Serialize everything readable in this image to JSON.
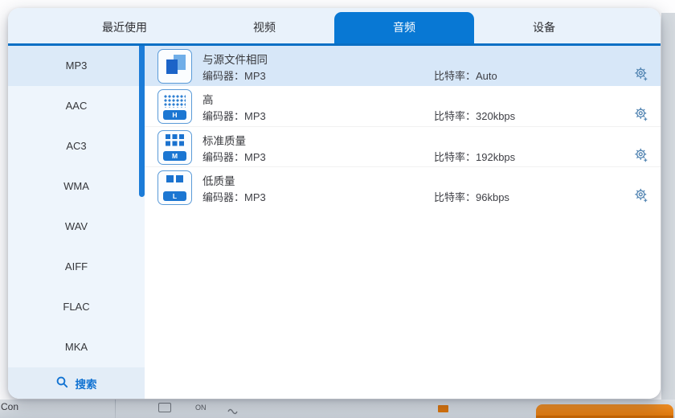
{
  "tabs": [
    {
      "label": "最近使用"
    },
    {
      "label": "视频"
    },
    {
      "label": "音频"
    },
    {
      "label": "设备"
    }
  ],
  "sidebar": {
    "items": [
      {
        "label": "MP3"
      },
      {
        "label": "AAC"
      },
      {
        "label": "AC3"
      },
      {
        "label": "WMA"
      },
      {
        "label": "WAV"
      },
      {
        "label": "AIFF"
      },
      {
        "label": "FLAC"
      },
      {
        "label": "MKA"
      }
    ],
    "search_label": "搜索"
  },
  "presets": [
    {
      "title": "与源文件相同",
      "encoder": "编码器：MP3",
      "bitrate": "比特率：Auto",
      "badge": "",
      "icon": "same-as-source-icon"
    },
    {
      "title": "高",
      "encoder": "编码器：MP3",
      "bitrate": "比特率：320kbps",
      "badge": "H",
      "icon": "high-quality-icon"
    },
    {
      "title": "标准质量",
      "encoder": "编码器：MP3",
      "bitrate": "比特率：192kbps",
      "badge": "M",
      "icon": "medium-quality-icon"
    },
    {
      "title": "低质量",
      "encoder": "编码器：MP3",
      "bitrate": "比特率：96kbps",
      "badge": "L",
      "icon": "low-quality-icon"
    }
  ],
  "backdrop": {
    "left_text": "Con",
    "on_label": "ON"
  },
  "colors": {
    "accent": "#0878d4",
    "tab_line": "#0a6fc4",
    "row_highlight": "#d7e7f8",
    "sidebar_bg": "#eef5fc",
    "gear": "#4d81b0",
    "orange": "#e0770e"
  }
}
